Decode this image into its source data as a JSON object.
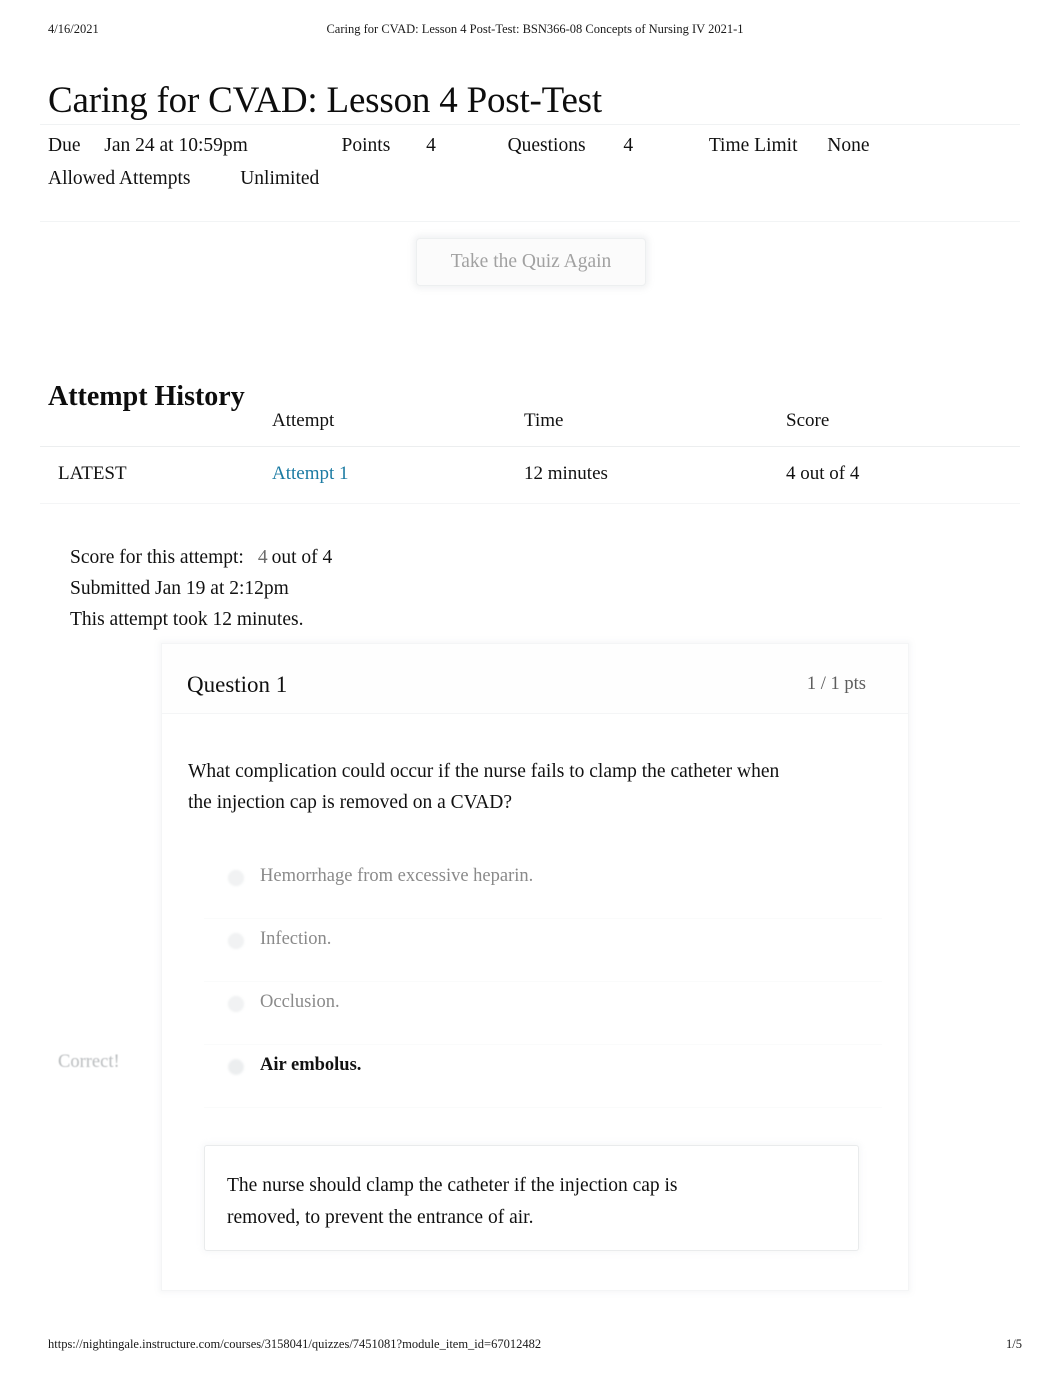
{
  "print_header": {
    "date": "4/16/2021",
    "title": "Caring for CVAD: Lesson 4 Post-Test: BSN366-08 Concepts of Nursing IV 2021-1"
  },
  "page_title": "Caring for CVAD: Lesson 4 Post-Test",
  "quiz_meta": {
    "due_label": "Due",
    "due_value": "Jan 24 at 10:59pm",
    "points_label": "Points",
    "points_value": "4",
    "questions_label": "Questions",
    "questions_value": "4",
    "time_limit_label": "Time Limit",
    "time_limit_value": "None",
    "allowed_attempts_label": "Allowed Attempts",
    "allowed_attempts_value": "Unlimited"
  },
  "take_again_button": "Take the Quiz Again",
  "attempt_history": {
    "heading": "Attempt History",
    "columns": [
      "",
      "Attempt",
      "Time",
      "Score"
    ],
    "rows": [
      {
        "kept": "LATEST",
        "attempt": "Attempt 1",
        "time": "12 minutes",
        "score": "4 out of 4"
      }
    ]
  },
  "score_summary": {
    "score_label": "Score for this attempt:",
    "score_value": "4",
    "score_suffix": "out of 4",
    "submitted": "Submitted Jan 19 at 2:12pm",
    "duration": "This attempt took 12 minutes."
  },
  "question": {
    "title": "Question 1",
    "points": "1 / 1 pts",
    "text": "What complication could occur if the nurse fails to clamp the catheter when the injection cap is removed on a CVAD?",
    "answers": [
      {
        "label": "Hemorrhage from excessive heparin.",
        "selected": false
      },
      {
        "label": "Infection.",
        "selected": false
      },
      {
        "label": "Occlusion.",
        "selected": false
      },
      {
        "label": "Air embolus.",
        "selected": true
      }
    ],
    "correct_marker": "Correct!",
    "feedback": "The nurse should clamp the catheter if the injection cap is removed, to prevent the entrance of air."
  },
  "footer": {
    "url": "https://nightingale.instructure.com/courses/3158041/quizzes/7451081?module_item_id=67012482",
    "page": "1/5"
  },
  "colors": {
    "link": "#1c7ba3",
    "muted_text": "#8a8a8a",
    "border": "#f4f5f6"
  }
}
